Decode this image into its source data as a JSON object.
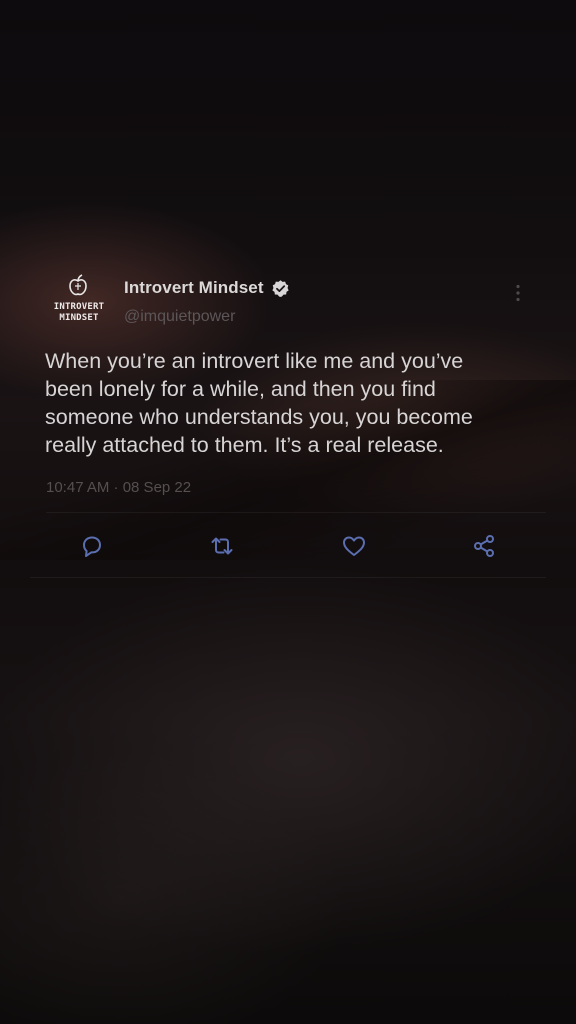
{
  "tweet": {
    "author": {
      "name": "Introvert Mindset",
      "handle": "@imquietpower",
      "verified": true,
      "avatar": {
        "line1": "INTROVERT",
        "line2": "MINDSET"
      }
    },
    "text_lines": [
      "When you’re an introvert like me and you’ve",
      "been lonely for a while, and then you find",
      "someone who understands you, you become",
      "really attached to them. It’s a real release."
    ],
    "timestamp": "10:47 AM · 08 Sep 22",
    "actions": [
      "reply-icon",
      "retweet-icon",
      "like-icon",
      "share-icon"
    ]
  },
  "colors": {
    "text": "#d7d4d5",
    "muted": "#5c5658",
    "icon": "#5b6fb0",
    "verified_badge": "#d9d6d7"
  }
}
